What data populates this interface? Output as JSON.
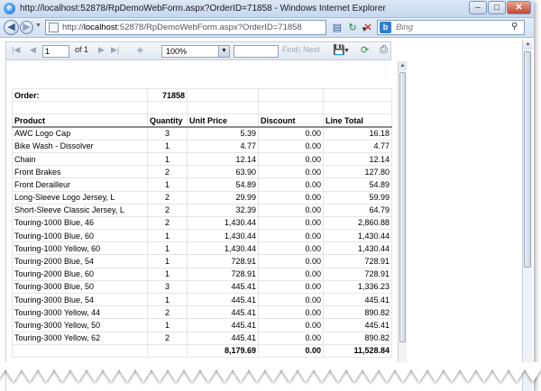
{
  "window": {
    "title": "http://localhost:52878/RpDemoWebForm.aspx?OrderID=71858 - Windows Internet Explorer",
    "minimize": "–",
    "maximize": "□",
    "close": "✕"
  },
  "address_bar": {
    "prefix": "http://",
    "host": "localhost",
    "rest": ":52878/RpDemoWebForm.aspx?OrderID=71858",
    "search_placeholder": "Bing"
  },
  "report_toolbar": {
    "page_current": "1",
    "page_of": "of 1",
    "zoom": "100%",
    "find_label": "Find",
    "find_separator": "|",
    "next_label": "Next"
  },
  "report": {
    "order_label": "Order:",
    "order_id": "71858",
    "columns": [
      "Product",
      "Quantity",
      "Unit Price",
      "Discount",
      "Line Total"
    ],
    "rows": [
      [
        "AWC Logo Cap",
        "3",
        "5.39",
        "0.00",
        "16.18"
      ],
      [
        "Bike Wash - Dissolver",
        "1",
        "4.77",
        "0.00",
        "4.77"
      ],
      [
        "Chain",
        "1",
        "12.14",
        "0.00",
        "12.14"
      ],
      [
        "Front Brakes",
        "2",
        "63.90",
        "0.00",
        "127.80"
      ],
      [
        "Front Derailleur",
        "1",
        "54.89",
        "0.00",
        "54.89"
      ],
      [
        "Long-Sleeve Logo Jersey, L",
        "2",
        "29.99",
        "0.00",
        "59.99"
      ],
      [
        "Short-Sleeve Classic Jersey, L",
        "2",
        "32.39",
        "0.00",
        "64.79"
      ],
      [
        "Touring-1000 Blue, 46",
        "2",
        "1,430.44",
        "0.00",
        "2,860.88"
      ],
      [
        "Touring-1000 Blue, 60",
        "1",
        "1,430.44",
        "0.00",
        "1,430.44"
      ],
      [
        "Touring-1000 Yellow, 60",
        "1",
        "1,430.44",
        "0.00",
        "1,430.44"
      ],
      [
        "Touring-2000 Blue, 54",
        "1",
        "728.91",
        "0.00",
        "728.91"
      ],
      [
        "Touring-2000 Blue, 60",
        "1",
        "728.91",
        "0.00",
        "728.91"
      ],
      [
        "Touring-3000 Blue, 50",
        "3",
        "445.41",
        "0.00",
        "1,336.23"
      ],
      [
        "Touring-3000 Blue, 54",
        "1",
        "445.41",
        "0.00",
        "445.41"
      ],
      [
        "Touring-3000 Yellow, 44",
        "2",
        "445.41",
        "0.00",
        "890.82"
      ],
      [
        "Touring-3000 Yellow, 50",
        "1",
        "445.41",
        "0.00",
        "445.41"
      ],
      [
        "Touring-3000 Yellow, 62",
        "2",
        "445.41",
        "0.00",
        "890.82"
      ]
    ],
    "totals": {
      "unit_price": "8,179.69",
      "discount": "0.00",
      "line_total": "11,528.84"
    }
  },
  "icons": {
    "browser_logo": "internet-explorer-icon",
    "back": "back-arrow-icon",
    "forward": "forward-arrow-icon",
    "refresh": "refresh-icon",
    "stop": "stop-icon",
    "search_provider": "bing-icon",
    "search": "search-icon",
    "first_page": "first-page-icon",
    "prev_page": "previous-page-icon",
    "next_page": "next-page-icon",
    "last_page": "last-page-icon",
    "back_to_parent": "back-to-parent-icon",
    "export": "export-save-icon",
    "print": "print-icon"
  }
}
